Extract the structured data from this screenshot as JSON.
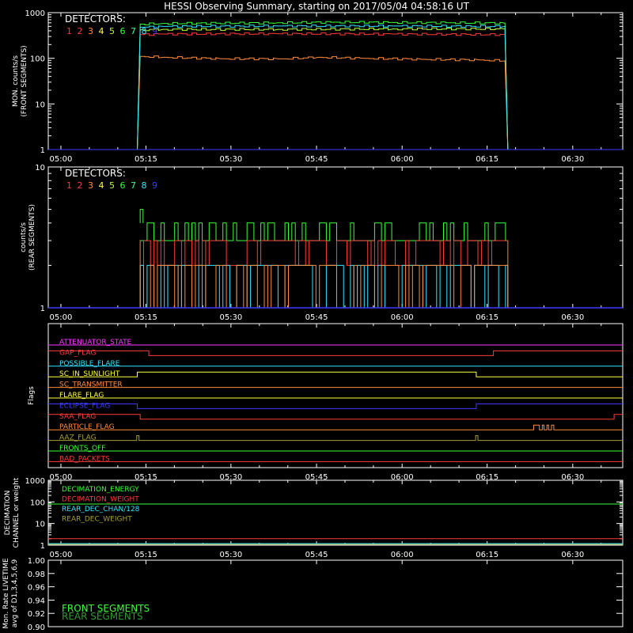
{
  "title": "HESSI Observing Summary, starting on 2017/05/04 04:58:16 UT",
  "colors": {
    "d1": "#ff3b3b",
    "d2": "#ff3b3b",
    "d3": "#ff8c3c",
    "d4": "#ffff3a",
    "d5": "#b5ff3a",
    "d6": "#3aff3a",
    "d7": "#3aff8c",
    "d8": "#33e6ff",
    "d9": "#3b3bff",
    "magenta": "#ff38ff",
    "olive": "#a8a030",
    "axis": "#ffffff"
  },
  "x_ticks": [
    "05:00",
    "05:15",
    "05:30",
    "05:45",
    "06:00",
    "06:15",
    "06:30"
  ],
  "chart_data": [
    {
      "type": "line",
      "panel": "front",
      "ylabel": "MON. counts/s\n(FRONT SEGMENTS)",
      "yscale": "log",
      "ylim": [
        1,
        1000
      ],
      "y_ticks": [
        "1",
        "10",
        "100",
        "1000"
      ],
      "legend_title": "DETECTORS:",
      "legend_numbers": [
        "1",
        "2",
        "3",
        "4",
        "5",
        "6",
        "7",
        "8",
        "9"
      ],
      "series": [
        {
          "detector": "1",
          "points": [
            [
              0,
              1
            ],
            [
              15.5,
              1
            ],
            [
              16.0,
              330
            ],
            [
              20,
              340
            ],
            [
              40,
              345
            ],
            [
              60,
              340
            ],
            [
              79.5,
              330
            ],
            [
              80.0,
              1
            ],
            [
              100,
              1
            ]
          ]
        },
        {
          "detector": "3",
          "points": [
            [
              0,
              1
            ],
            [
              15.5,
              1
            ],
            [
              16.0,
              110
            ],
            [
              20,
              105
            ],
            [
              30,
              98
            ],
            [
              40,
              97
            ],
            [
              47,
              105
            ],
            [
              55,
              100
            ],
            [
              65,
              95
            ],
            [
              75,
              92
            ],
            [
              79.5,
              88
            ],
            [
              80.0,
              1
            ],
            [
              100,
              1
            ]
          ]
        },
        {
          "detector": "5",
          "points": [
            [
              0,
              1
            ],
            [
              15.5,
              1
            ],
            [
              16.0,
              420
            ],
            [
              20,
              430
            ],
            [
              40,
              430
            ],
            [
              60,
              440
            ],
            [
              79.5,
              440
            ],
            [
              80.0,
              1
            ],
            [
              100,
              1
            ]
          ]
        },
        {
          "detector": "6",
          "points": [
            [
              0,
              1
            ],
            [
              15.5,
              1
            ],
            [
              16.0,
              560
            ],
            [
              20,
              580
            ],
            [
              40,
              600
            ],
            [
              50,
              620
            ],
            [
              60,
              610
            ],
            [
              70,
              600
            ],
            [
              79.5,
              590
            ],
            [
              80.0,
              1
            ],
            [
              100,
              1
            ]
          ]
        },
        {
          "detector": "8",
          "points": [
            [
              0,
              1
            ],
            [
              15.5,
              1
            ],
            [
              16.0,
              480
            ],
            [
              20,
              500
            ],
            [
              40,
              510
            ],
            [
              60,
              510
            ],
            [
              79.5,
              500
            ],
            [
              80.0,
              1
            ],
            [
              100,
              1
            ]
          ]
        },
        {
          "detector": "9",
          "points": [
            [
              0,
              1
            ],
            [
              100,
              1
            ]
          ]
        }
      ]
    },
    {
      "type": "line",
      "panel": "rear",
      "ylabel": "counts/s\n(REAR SEGMENTS)",
      "yscale": "log",
      "ylim": [
        1,
        10
      ],
      "y_ticks": [
        "1",
        "10"
      ],
      "legend_title": "DETECTORS:",
      "legend_numbers": [
        "1",
        "2",
        "3",
        "4",
        "5",
        "6",
        "7",
        "8",
        "9"
      ],
      "series": [
        {
          "detector": "6",
          "description": "green rate steps between 3 and 4 counts/s, occasional 5",
          "base": 3,
          "alt": 4,
          "start": 16,
          "end": 80
        },
        {
          "detector": "1",
          "description": "red rate steps between 2 and 3 counts/s",
          "base": 3,
          "alt": 2,
          "start": 16,
          "end": 80
        },
        {
          "detector": "8",
          "description": "cyan rate steps between 2 and 1 counts/s",
          "base": 2,
          "alt": 1,
          "start": 16,
          "end": 80
        },
        {
          "detector": "3",
          "description": "orange rate near 2 counts/s",
          "base": 2,
          "alt": 1,
          "start": 16,
          "end": 80
        },
        {
          "detector": "9",
          "points": [
            [
              0,
              1
            ],
            [
              100,
              1
            ]
          ]
        }
      ]
    },
    {
      "type": "line",
      "panel": "flags",
      "ylabel": "Flags",
      "flags": [
        {
          "label": "ATTENUATOR_STATE",
          "color": "#ff38ff",
          "steps": [
            [
              0,
              0
            ],
            [
              100,
              0
            ]
          ]
        },
        {
          "label": "GAP_FLAG",
          "color": "#ff3b3b",
          "steps": [
            [
              0,
              1
            ],
            [
              17.5,
              1
            ],
            [
              17.5,
              0
            ],
            [
              77.5,
              0
            ],
            [
              77.5,
              1
            ],
            [
              100,
              1
            ]
          ]
        },
        {
          "label": "POSSIBLE_FLARE",
          "color": "#33e6ff",
          "steps": [
            [
              0,
              0
            ],
            [
              100,
              0
            ]
          ]
        },
        {
          "label": "SC_IN_SUNLIGHT",
          "color": "#ffff3a",
          "steps": [
            [
              0,
              0
            ],
            [
              15.5,
              0
            ],
            [
              15.5,
              1
            ],
            [
              74.5,
              1
            ],
            [
              74.5,
              0
            ],
            [
              100,
              0
            ]
          ]
        },
        {
          "label": "SC_TRANSMITTER",
          "color": "#ff8c3c",
          "steps": [
            [
              0,
              0
            ],
            [
              100,
              0
            ]
          ]
        },
        {
          "label": "FLARE_FLAG",
          "color": "#ffff3a",
          "steps": [
            [
              0,
              0
            ],
            [
              100,
              0
            ]
          ]
        },
        {
          "label": "ECLIPSE_FLAG",
          "color": "#3b3bff",
          "steps": [
            [
              0,
              1
            ],
            [
              15.5,
              1
            ],
            [
              15.5,
              0
            ],
            [
              74.5,
              0
            ],
            [
              74.5,
              1
            ],
            [
              100,
              1
            ]
          ]
        },
        {
          "label": "SAA_FLAG",
          "color": "#ff3b3b",
          "steps": [
            [
              0,
              1
            ],
            [
              16.0,
              1
            ],
            [
              16.0,
              0
            ],
            [
              98.5,
              0
            ],
            [
              98.5,
              1
            ],
            [
              100,
              1
            ]
          ]
        },
        {
          "label": "PARTICLE_FLAG",
          "color": "#ff8c3c",
          "steps": [
            [
              0,
              0
            ],
            [
              84.5,
              0
            ],
            [
              84.5,
              1
            ],
            [
              85.5,
              1
            ],
            [
              85.5,
              0
            ],
            [
              86.0,
              0
            ],
            [
              86.0,
              1
            ],
            [
              86.3,
              1
            ],
            [
              86.3,
              0
            ],
            [
              86.8,
              0
            ],
            [
              86.8,
              1
            ],
            [
              87.1,
              1
            ],
            [
              87.1,
              0
            ],
            [
              87.6,
              0
            ],
            [
              87.6,
              1
            ],
            [
              88.0,
              1
            ],
            [
              88.0,
              0
            ],
            [
              100,
              0
            ]
          ]
        },
        {
          "label": "AAZ_FLAG",
          "color": "#a8a030",
          "steps": [
            [
              0,
              0
            ],
            [
              15.4,
              0
            ],
            [
              15.4,
              1
            ],
            [
              15.8,
              1
            ],
            [
              15.8,
              0
            ],
            [
              74.4,
              0
            ],
            [
              74.4,
              1
            ],
            [
              74.8,
              1
            ],
            [
              74.8,
              0
            ],
            [
              100,
              0
            ]
          ]
        },
        {
          "label": "FRONTS_OFF",
          "color": "#3aff3a",
          "steps": [
            [
              0,
              0
            ],
            [
              100,
              0
            ]
          ]
        },
        {
          "label": "BAD_PACKETS",
          "color": "#ff3b3b",
          "steps": [
            [
              0,
              0
            ],
            [
              100,
              0
            ]
          ]
        }
      ]
    },
    {
      "type": "line",
      "panel": "decimation",
      "ylabel": "DECIMATION\nCHANNEL or weight",
      "yscale": "log",
      "ylim": [
        1,
        1000
      ],
      "y_ticks": [
        "1",
        "10",
        "100",
        "1000"
      ],
      "series": [
        {
          "name": "DECIMATION_ENERGY",
          "color": "#3aff3a",
          "value": 80
        },
        {
          "name": "DECIMATION_WEIGHT",
          "color": "#ff3b3b",
          "value": 2
        },
        {
          "name": "REAR_DEC_CHAN/128",
          "color": "#33e6ff",
          "value": 1
        },
        {
          "name": "REAR_DEC_WEIGHT",
          "color": "#a8a030",
          "value": 1
        }
      ]
    },
    {
      "type": "line",
      "panel": "livetime",
      "ylabel": "Mon. Rate LIVETIME\navg of D1,3,4,5,6,9",
      "ylim": [
        0.9,
        1.0
      ],
      "y_ticks": [
        "0.90",
        "0.92",
        "0.94",
        "0.96",
        "0.98",
        "1.00"
      ],
      "legend": [
        {
          "name": "FRONT SEGMENTS",
          "color": "#3aff3a"
        },
        {
          "name": "REAR SEGMENTS",
          "color": "#2f9a2f"
        }
      ]
    }
  ]
}
